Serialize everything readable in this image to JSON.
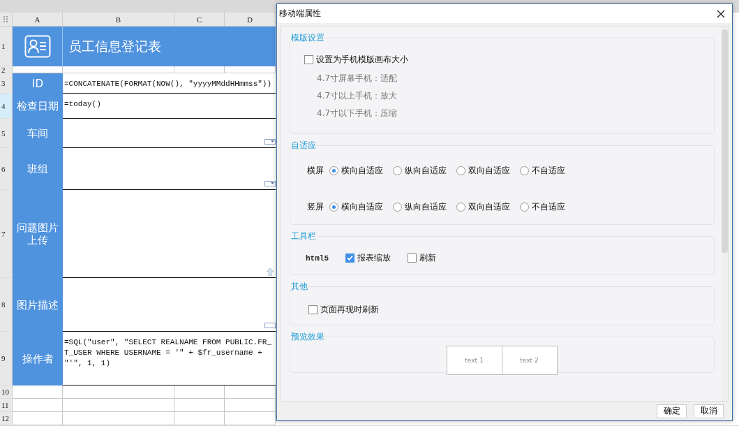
{
  "sheet": {
    "columns": [
      "A",
      "B",
      "C",
      "D"
    ],
    "row_numbers": [
      {
        "label": "1",
        "selected": false
      },
      {
        "label": "2",
        "selected": false
      },
      {
        "label": "3",
        "selected": false
      },
      {
        "label": "4",
        "selected": true
      },
      {
        "label": "5",
        "selected": false
      },
      {
        "label": "6",
        "selected": false
      },
      {
        "label": "7",
        "selected": false
      },
      {
        "label": "8",
        "selected": false
      },
      {
        "label": "9",
        "selected": false
      },
      {
        "label": "10",
        "selected": false
      },
      {
        "label": "11",
        "selected": false
      },
      {
        "label": "12",
        "selected": false
      }
    ],
    "title": "员工信息登记表",
    "fields": [
      {
        "label": "ID",
        "kind": "formula",
        "value": "=CONCATENATE(FORMAT(NOW(), \"yyyyMMddHHmmss\"))"
      },
      {
        "label": "检查日期",
        "kind": "formula",
        "value": "=today()"
      },
      {
        "label": "车间",
        "kind": "dropdown"
      },
      {
        "label": "班组",
        "kind": "dropdown"
      },
      {
        "label": "问题图片上传",
        "kind": "upload"
      },
      {
        "label": "图片描述",
        "kind": "textarea"
      },
      {
        "label": "操作者",
        "kind": "formula",
        "value": "=SQL(\"user\", \"SELECT REALNAME FROM PUBLIC.FR_T_USER WHERE USERNAME = '\" + $fr_username + \"'\", 1, 1)"
      }
    ]
  },
  "dialog": {
    "title": "移动端属性",
    "sections": [
      {
        "kind": "template",
        "legend": "模版设置",
        "checkbox": {
          "label": "设置为手机模版画布大小",
          "checked": false
        },
        "notes": [
          "4.7寸屏幕手机：适配",
          "4.7寸以上手机：放大",
          "4.7寸以下手机：压缩"
        ]
      },
      {
        "kind": "adaptive",
        "legend": "自适应",
        "rows": [
          {
            "label": "横屏",
            "options": [
              {
                "label": "横向自适应",
                "selected": true
              },
              {
                "label": "纵向自适应",
                "selected": false
              },
              {
                "label": "双向自适应",
                "selected": false
              },
              {
                "label": "不自适应",
                "selected": false
              }
            ]
          },
          {
            "label": "竖屏",
            "options": [
              {
                "label": "横向自适应",
                "selected": true
              },
              {
                "label": "纵向自适应",
                "selected": false
              },
              {
                "label": "双向自适应",
                "selected": false
              },
              {
                "label": "不自适应",
                "selected": false
              }
            ]
          }
        ]
      },
      {
        "kind": "toolbar",
        "legend": "工具栏",
        "label": "html5",
        "checkboxes": [
          {
            "label": "报表缩放",
            "checked": true
          },
          {
            "label": "刷新",
            "checked": false
          }
        ]
      },
      {
        "kind": "other",
        "legend": "其他",
        "checkbox": {
          "label": "页面再现时刷新",
          "checked": false
        }
      },
      {
        "kind": "preview",
        "legend": "预览效果",
        "cells": [
          "text 1",
          "text 2"
        ]
      }
    ],
    "buttons": [
      "确定",
      "取消"
    ]
  }
}
